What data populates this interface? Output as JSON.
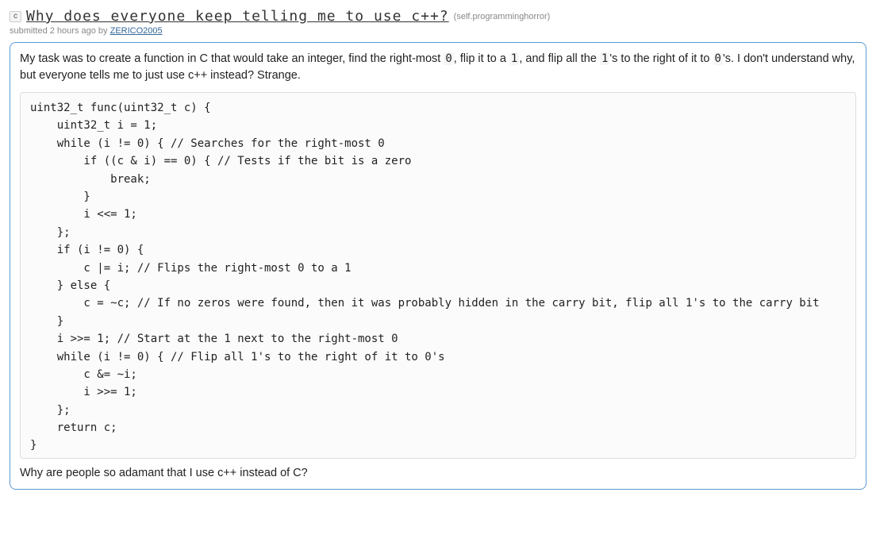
{
  "header": {
    "flair": "c",
    "title": "Why does everyone keep telling me to use c++?",
    "domain": "(self.programminghorror)",
    "submitted_prefix": "submitted ",
    "age": "2 hours ago",
    "by": " by ",
    "author": "ZERICO2005"
  },
  "body": {
    "intro_a": "My task was to create a function in C that would take an integer, find the right-most ",
    "intro_code1": "0",
    "intro_b": ", flip it to a ",
    "intro_code2": "1",
    "intro_c": ", and flip all the ",
    "intro_code3": "1",
    "intro_d": "'s to the right of it to ",
    "intro_code4": "0",
    "intro_e": "'s. I don't understand why, but everyone tells me to just use c++ instead? Strange.",
    "code": "uint32_t func(uint32_t c) {\n    uint32_t i = 1;\n    while (i != 0) { // Searches for the right-most 0\n        if ((c & i) == 0) { // Tests if the bit is a zero\n            break;\n        }\n        i <<= 1;\n    };\n    if (i != 0) {\n        c |= i; // Flips the right-most 0 to a 1\n    } else {\n        c = ~c; // If no zeros were found, then it was probably hidden in the carry bit, flip all 1's to the carry bit\n    }\n    i >>= 1; // Start at the 1 next to the right-most 0\n    while (i != 0) { // Flip all 1's to the right of it to 0's\n        c &= ~i;\n        i >>= 1;\n    };\n    return c;\n}",
    "outro": "Why are people so adamant that I use c++ instead of C?"
  }
}
